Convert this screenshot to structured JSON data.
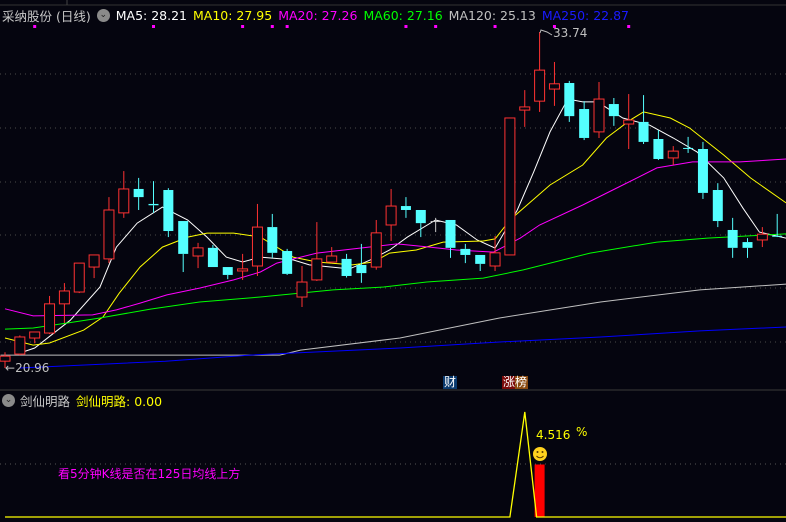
{
  "header": {
    "stock_name": "采纳股份 (日线)",
    "ma": [
      {
        "label": "MA5: 28.21",
        "color": "#ffffff"
      },
      {
        "label": "MA10: 27.95",
        "color": "#ffff00"
      },
      {
        "label": "MA20: 27.26",
        "color": "#ff00ff"
      },
      {
        "label": "MA60: 27.16",
        "color": "#00ff00"
      },
      {
        "label": "MA120: 25.13",
        "color": "#c0c0c0"
      },
      {
        "label": "MA250: 22.87",
        "color": "#0000ff"
      }
    ]
  },
  "price_labels": {
    "high": "33.74",
    "low": "20.96"
  },
  "badges": {
    "cai": "财",
    "zhangbang": "涨榜"
  },
  "colors": {
    "up": "#ff3232",
    "down": "#54ffff",
    "flat": "#c8c8c8",
    "marker": "#ff00ff"
  },
  "chart_data": {
    "type": "candlestick",
    "price_range": [
      20.96,
      33.74
    ],
    "markers_at_index": [
      2,
      10,
      16,
      18,
      19,
      27,
      29,
      33,
      37,
      42
    ],
    "candles_ohlc": [
      [
        21.22,
        21.56,
        20.96,
        21.41
      ],
      [
        21.49,
        22.2,
        21.45,
        22.14
      ],
      [
        22.1,
        22.33,
        21.9,
        22.33
      ],
      [
        22.29,
        23.7,
        22.25,
        23.4
      ],
      [
        23.4,
        24.19,
        22.67,
        23.89
      ],
      [
        23.85,
        24.95,
        23.81,
        24.95
      ],
      [
        24.8,
        25.26,
        24.38,
        25.26
      ],
      [
        25.11,
        27.46,
        24.95,
        26.97
      ],
      [
        26.86,
        28.45,
        26.67,
        27.77
      ],
      [
        27.77,
        28.19,
        26.97,
        27.46
      ],
      [
        27.2,
        28.07,
        26.86,
        27.15
      ],
      [
        27.73,
        27.8,
        25.94,
        26.17
      ],
      [
        26.55,
        26.55,
        24.61,
        25.3
      ],
      [
        25.22,
        25.72,
        24.76,
        25.53
      ],
      [
        25.53,
        25.64,
        24.8,
        24.8
      ],
      [
        24.8,
        24.8,
        24.34,
        24.5
      ],
      [
        24.65,
        25.3,
        24.31,
        24.73
      ],
      [
        24.84,
        27.2,
        24.46,
        26.32
      ],
      [
        26.32,
        26.82,
        25.15,
        25.34
      ],
      [
        25.41,
        25.49,
        24.5,
        24.54
      ],
      [
        23.66,
        24.84,
        23.28,
        24.23
      ],
      [
        24.31,
        26.51,
        24.27,
        25.11
      ],
      [
        24.99,
        25.56,
        24.95,
        25.22
      ],
      [
        25.11,
        25.3,
        24.4,
        24.46
      ],
      [
        24.88,
        25.68,
        24.2,
        24.57
      ],
      [
        24.8,
        26.59,
        24.7,
        26.1
      ],
      [
        26.4,
        27.77,
        25.79,
        27.12
      ],
      [
        27.12,
        27.46,
        26.67,
        26.97
      ],
      [
        26.97,
        26.97,
        25.94,
        26.47
      ],
      [
        26.55,
        26.67,
        26.13,
        26.55
      ],
      [
        26.59,
        26.59,
        25.15,
        25.53
      ],
      [
        25.49,
        25.68,
        24.95,
        25.26
      ],
      [
        25.26,
        25.26,
        24.65,
        24.92
      ],
      [
        24.84,
        25.98,
        24.65,
        25.34
      ],
      [
        25.26,
        30.47,
        25.26,
        30.47
      ],
      [
        30.77,
        31.53,
        30.13,
        30.89
      ],
      [
        31.11,
        33.74,
        30.7,
        32.29
      ],
      [
        31.57,
        32.6,
        30.93,
        31.77
      ],
      [
        31.8,
        31.88,
        30.32,
        30.54
      ],
      [
        30.81,
        31.11,
        29.63,
        29.71
      ],
      [
        29.94,
        31.84,
        29.71,
        31.19
      ],
      [
        31.0,
        31.23,
        30.17,
        30.54
      ],
      [
        30.24,
        31.38,
        29.29,
        30.39
      ],
      [
        30.32,
        31.34,
        29.48,
        29.56
      ],
      [
        29.67,
        30.01,
        28.87,
        28.91
      ],
      [
        28.95,
        29.4,
        28.68,
        29.21
      ],
      [
        29.33,
        29.75,
        29.14,
        29.32
      ],
      [
        29.29,
        29.56,
        27.39,
        27.62
      ],
      [
        27.73,
        27.99,
        26.32,
        26.55
      ],
      [
        26.21,
        26.67,
        25.15,
        25.53
      ],
      [
        25.75,
        25.9,
        25.15,
        25.53
      ],
      [
        25.83,
        26.32,
        25.56,
        26.05
      ],
      [
        25.99,
        26.82,
        25.94,
        25.97
      ]
    ],
    "ma_lines": [
      {
        "name": "MA5",
        "color": "#ffffff",
        "points": [
          [
            1,
            21.53
          ],
          [
            2,
            21.72
          ],
          [
            4.4,
            22.78
          ],
          [
            6.4,
            24.04
          ],
          [
            7.5,
            25.56
          ],
          [
            8.9,
            26.47
          ],
          [
            10.6,
            27.08
          ],
          [
            12.3,
            26.59
          ],
          [
            13.6,
            25.94
          ],
          [
            14.9,
            25.18
          ],
          [
            16,
            24.99
          ],
          [
            17.2,
            25.18
          ],
          [
            19.4,
            25.07
          ],
          [
            20.5,
            24.88
          ],
          [
            23.2,
            24.73
          ],
          [
            24.6,
            25.07
          ],
          [
            25.9,
            25.45
          ],
          [
            27.1,
            25.94
          ],
          [
            29,
            26.59
          ],
          [
            30.4,
            26.4
          ],
          [
            31.8,
            25.83
          ],
          [
            33,
            25.52
          ],
          [
            34.5,
            26.97
          ],
          [
            35.6,
            28.42
          ],
          [
            36.7,
            29.94
          ],
          [
            37.9,
            31.19
          ],
          [
            38.9,
            31.08
          ],
          [
            39.9,
            31.08
          ],
          [
            41.6,
            30.47
          ],
          [
            43.4,
            30.2
          ],
          [
            45,
            29.71
          ],
          [
            46.6,
            29.18
          ],
          [
            48.4,
            28.19
          ],
          [
            49.7,
            27.04
          ],
          [
            50.8,
            26.13
          ],
          [
            52.6,
            25.9
          ]
        ]
      },
      {
        "name": "MA10",
        "color": "#ffff00",
        "points": [
          [
            0,
            22.1
          ],
          [
            1.9,
            21.83
          ],
          [
            3,
            21.91
          ],
          [
            5.3,
            22.4
          ],
          [
            6.6,
            22.9
          ],
          [
            7.7,
            23.81
          ],
          [
            9.1,
            24.8
          ],
          [
            10.6,
            25.56
          ],
          [
            12.3,
            25.94
          ],
          [
            13.6,
            26.09
          ],
          [
            15.4,
            26.09
          ],
          [
            17.2,
            25.94
          ],
          [
            19.4,
            25.18
          ],
          [
            21,
            24.99
          ],
          [
            23.4,
            24.88
          ],
          [
            24.8,
            24.99
          ],
          [
            25.9,
            25.33
          ],
          [
            27.7,
            25.45
          ],
          [
            29.5,
            25.75
          ],
          [
            32.2,
            25.79
          ],
          [
            33,
            25.87
          ],
          [
            34,
            26.59
          ],
          [
            36.7,
            27.92
          ],
          [
            38.9,
            28.68
          ],
          [
            40.5,
            29.71
          ],
          [
            42.1,
            30.39
          ],
          [
            43,
            30.7
          ],
          [
            44.8,
            30.47
          ],
          [
            46.1,
            30.09
          ],
          [
            48.4,
            29.06
          ],
          [
            50.2,
            28.19
          ],
          [
            52.6,
            27.24
          ]
        ]
      },
      {
        "name": "MA20",
        "color": "#ff00ff",
        "points": [
          [
            0,
            23.21
          ],
          [
            1.9,
            22.94
          ],
          [
            5.9,
            22.98
          ],
          [
            7.5,
            23.17
          ],
          [
            9.1,
            23.43
          ],
          [
            10.9,
            23.74
          ],
          [
            13.1,
            24.0
          ],
          [
            15.4,
            24.31
          ],
          [
            17.2,
            24.61
          ],
          [
            18.3,
            24.95
          ],
          [
            21,
            25.33
          ],
          [
            23.9,
            25.52
          ],
          [
            26.4,
            25.68
          ],
          [
            28.6,
            25.56
          ],
          [
            30.4,
            25.45
          ],
          [
            32.9,
            25.37
          ],
          [
            34.7,
            25.9
          ],
          [
            36,
            26.4
          ],
          [
            38.9,
            27.16
          ],
          [
            41.6,
            27.92
          ],
          [
            43.9,
            28.57
          ],
          [
            46.3,
            28.8
          ],
          [
            49.5,
            28.8
          ],
          [
            52.6,
            28.91
          ]
        ]
      },
      {
        "name": "MA60",
        "color": "#00ff00",
        "points": [
          [
            0,
            22.44
          ],
          [
            1.9,
            22.48
          ],
          [
            4.2,
            22.67
          ],
          [
            6.4,
            22.86
          ],
          [
            9.8,
            23.2
          ],
          [
            13.1,
            23.47
          ],
          [
            17.2,
            23.66
          ],
          [
            22.1,
            23.93
          ],
          [
            25.5,
            24.04
          ],
          [
            28.4,
            24.23
          ],
          [
            32.2,
            24.38
          ],
          [
            34.9,
            24.69
          ],
          [
            39.4,
            25.33
          ],
          [
            43.9,
            25.75
          ],
          [
            47.3,
            25.9
          ],
          [
            52.6,
            26.06
          ]
        ]
      },
      {
        "name": "MA120",
        "color": "#c0c0c0",
        "points": [
          [
            -0.3,
            21.45
          ],
          [
            18.5,
            21.45
          ],
          [
            19.9,
            21.64
          ],
          [
            26.6,
            22.1
          ],
          [
            33.3,
            22.86
          ],
          [
            40.1,
            23.47
          ],
          [
            46.8,
            23.93
          ],
          [
            52.6,
            24.15
          ]
        ]
      },
      {
        "name": "MA250",
        "color": "#0000ff",
        "points": [
          [
            1,
            20.96
          ],
          [
            10.8,
            21.22
          ],
          [
            16.5,
            21.45
          ],
          [
            26.6,
            21.72
          ],
          [
            33.3,
            21.95
          ],
          [
            40.1,
            22.14
          ],
          [
            46.8,
            22.37
          ],
          [
            52.6,
            22.52
          ]
        ]
      }
    ]
  },
  "indicator": {
    "name": "剑仙明路",
    "value_label": "剑仙明路: 0.00",
    "note": "看5分钟K线是否在125日均线上方",
    "percent_value": "4.516",
    "percent_sign": "%",
    "line_values": [
      [
        0,
        0
      ],
      [
        34,
        0
      ],
      [
        35,
        1
      ],
      [
        35.8,
        0
      ],
      [
        52.6,
        0
      ]
    ],
    "bar": {
      "index": 36,
      "value": 0.5
    },
    "range": [
      0,
      1
    ]
  }
}
